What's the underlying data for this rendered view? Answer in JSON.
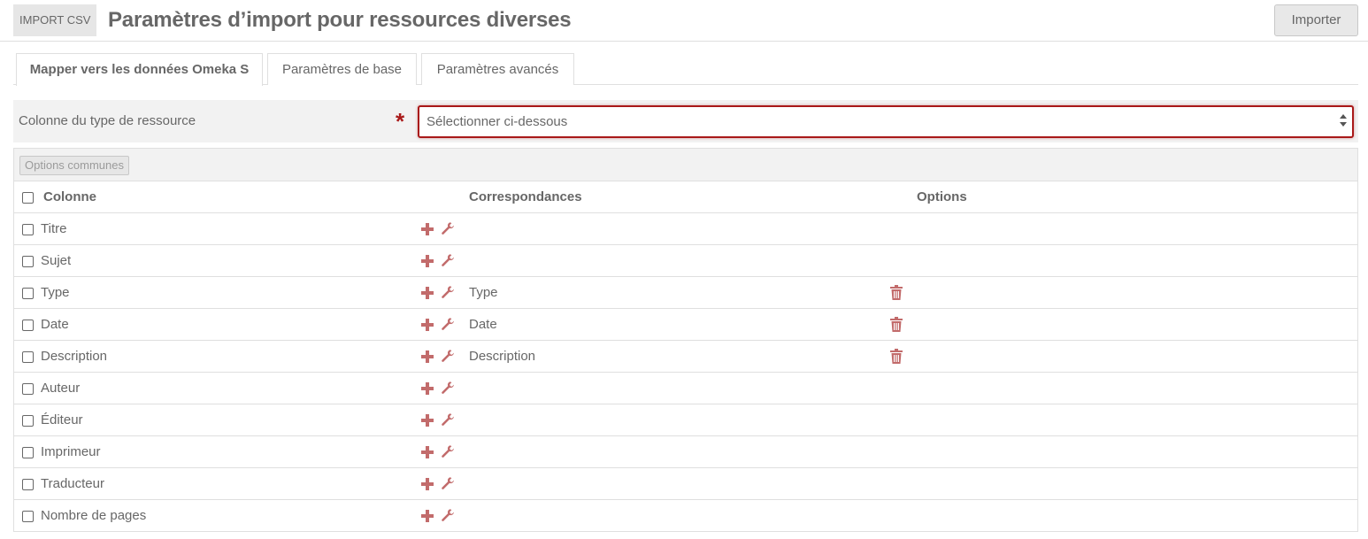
{
  "header": {
    "module_badge": "IMPORT CSV",
    "title": "Paramètres d’import pour ressources diverses",
    "import_button": "Importer"
  },
  "tabs": [
    {
      "label": "Mapper vers les données Omeka S",
      "active": true
    },
    {
      "label": "Paramètres de base",
      "active": false
    },
    {
      "label": "Paramètres avancés",
      "active": false
    }
  ],
  "resource_type": {
    "label": "Colonne du type de ressource",
    "required_mark": "*",
    "select_value": "Sélectionner ci-dessous"
  },
  "table": {
    "common_options_button": "Options communes",
    "headers": {
      "column": "Colonne",
      "mappings": "Correspondances",
      "options": "Options"
    },
    "rows": [
      {
        "label": "Titre",
        "mapping": ""
      },
      {
        "label": "Sujet",
        "mapping": ""
      },
      {
        "label": "Type",
        "mapping": "Type"
      },
      {
        "label": "Date",
        "mapping": "Date"
      },
      {
        "label": "Description",
        "mapping": "Description"
      },
      {
        "label": "Auteur",
        "mapping": ""
      },
      {
        "label": "Éditeur",
        "mapping": ""
      },
      {
        "label": "Imprimeur",
        "mapping": ""
      },
      {
        "label": "Traducteur",
        "mapping": ""
      },
      {
        "label": "Nombre de pages",
        "mapping": ""
      }
    ]
  },
  "icons": {
    "add": "plus-icon",
    "configure": "wrench-icon",
    "delete": "trash-icon"
  },
  "colors": {
    "accent": "#a91919",
    "icon": "#c26b6b",
    "text": "#676767",
    "border": "#dfdfdf",
    "panel": "#f2f2f2"
  }
}
